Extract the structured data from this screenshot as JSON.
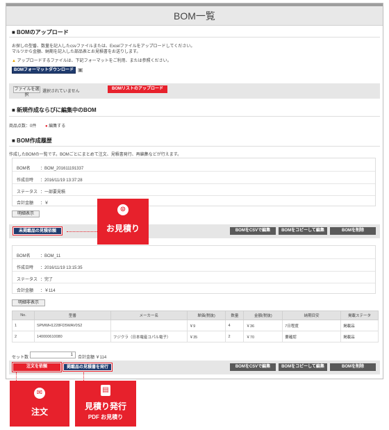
{
  "page_title": "BOM一覧",
  "upload": {
    "heading": "■ BOMのアップロード",
    "desc1": "お探しの型番、数量を記入したcsvファイルまたは、Excelファイルをアップロードしてください。",
    "desc2": "マルツから金額、納期を記入した部品表とお見積書をお送りします。",
    "notice": "アップロードするファイルは、下記フォーマットをご利用、または参照ください。",
    "download_btn": "BOMフォーマットダウンロード",
    "choose_file_btn": "ファイルを選択",
    "no_file_text": "選択されていません",
    "upload_btn": "BOMリストのアップロード"
  },
  "editing": {
    "heading": "■ 新規作成ならびに編集中のBOM",
    "count_text": "商品点数：0件",
    "edit_link": "編集する"
  },
  "history": {
    "heading": "■ BOM作成履歴",
    "desc": "作成したBOMの一覧です。BOMごとにまとめて注文、見積書発行、再編集などが行えます。"
  },
  "bom1": {
    "name_label": "BOM名",
    "name_value": "：BOM_201611191337",
    "created_label": "作成日時",
    "created_value": "：2016/11/19 13:37:28",
    "status_label": "ステータス",
    "status_value": "：一部要見積",
    "total_label": "合計金額",
    "total_value": "：￥",
    "details_btn": "明細表示",
    "quote_request_btn": "未掲載品の見積依頼",
    "csv_btn": "BOMをCSVで編集",
    "copy_btn": "BOMをコピーして編集",
    "delete_btn": "BOMを削除"
  },
  "bom2": {
    "name_label": "BOM名",
    "name_value": "：BOM_11",
    "created_label": "作成日時",
    "created_value": "：2016/11/19 13:15:35",
    "status_label": "ステータス",
    "status_value": "：完了",
    "total_label": "合計金額",
    "total_value": "：￥114",
    "hide_details_btn": "明細非表示",
    "table": {
      "headers": [
        "No.",
        "型番",
        "メーカー名",
        "単価(税抜)",
        "数量",
        "金額(税抜)",
        "納期目安",
        "掲載ステータ"
      ],
      "rows": [
        [
          "1",
          "SPMWH1228FD5WAV0S2",
          "",
          "￥9",
          "4",
          "￥36",
          "7日程度",
          "掲載品"
        ],
        [
          "2",
          "140000610080",
          "フジクラ（日本電産コパル電子）",
          "￥35",
          "2",
          "￥70",
          "要確認",
          "掲載品"
        ]
      ]
    },
    "set_count_label": "セット数",
    "set_count_value": "1",
    "set_total_text": "合計金額 ￥114",
    "order_btn": "注文を依頼",
    "quote_issue_btn": "掲載品の見積書を発行",
    "csv_btn": "BOMをCSVで編集",
    "copy_btn": "BOMをコピーして編集",
    "delete_btn": "BOMを削除"
  },
  "callouts": {
    "quote": "お見積り",
    "order": "注文",
    "issue_line1": "見積り発行",
    "issue_line2": "PDF お見積り"
  },
  "colors": {
    "accent_red": "#e7212c",
    "navy": "#1f3b6e",
    "dark_gray": "#5a5a5a"
  }
}
